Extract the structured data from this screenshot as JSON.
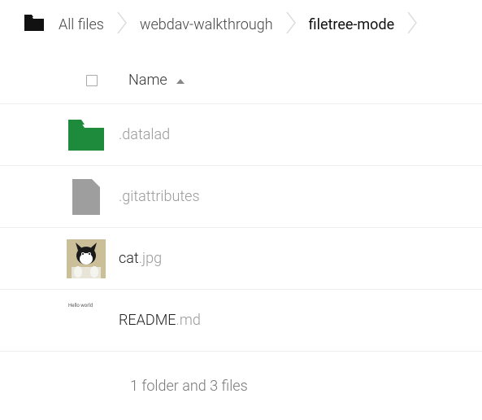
{
  "breadcrumb": {
    "root": "All files",
    "items": [
      "webdav-walkthrough",
      "filetree-mode"
    ]
  },
  "header": {
    "name_label": "Name"
  },
  "rows": [
    {
      "type": "folder",
      "name": ".datalad",
      "ext": ""
    },
    {
      "type": "file",
      "name": ".gitattributes",
      "ext": ""
    },
    {
      "type": "image",
      "name": "cat",
      "ext": ".jpg"
    },
    {
      "type": "text",
      "name": "README",
      "ext": ".md",
      "preview": "Hello world"
    }
  ],
  "summary": "1 folder and 3 files",
  "icons": {
    "home": "home-folder-icon",
    "chevron": "chevron-right-icon",
    "sort": "sort-asc-icon"
  },
  "colors": {
    "folder": "#1e8a3b",
    "file": "#9e9e9e",
    "text_muted": "#999"
  }
}
